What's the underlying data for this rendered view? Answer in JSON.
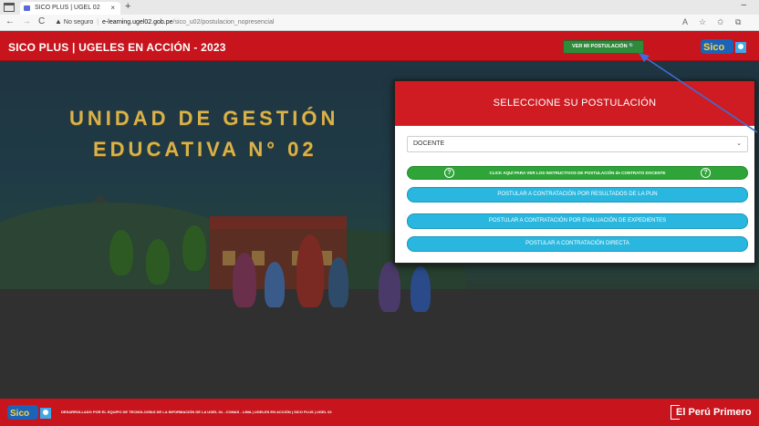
{
  "browser": {
    "tab_title": "SICO PLUS | UGEL 02",
    "tab_close": "×",
    "new_tab": "+",
    "minimize": "–",
    "back": "←",
    "forward": "→",
    "reload": "C",
    "insecure_label": "No seguro",
    "url_host": "e-learning.ugel02.gob.pe",
    "url_path": "/sico_u02/postulacion_nopresencial"
  },
  "header": {
    "title": "SICO PLUS | UGELES EN ACCIÓN - 2023",
    "ver_button": "VER MI POSTULACIÓN 🔍",
    "logo_text": "Sico"
  },
  "hero": {
    "line1": "UNIDAD DE GESTIÓN",
    "line2": "EDUCATIVA N° 02"
  },
  "modal": {
    "title": "SELECCIONE SU POSTULACIÓN",
    "select_value": "DOCENTE",
    "green_button": "CLICK AQUÍ PARA VER LOS INSTRUCTIVOS DE POSTULACIÓN de CONTRATO DOCENTE",
    "help_icon": "?",
    "buttons": [
      "POSTULAR A CONTRATACIÓN POR RESULTADOS DE LA PUN",
      "POSTULAR A CONTRATACIÓN POR EVALUACIÓN DE EXPEDIENTES",
      "POSTULAR A CONTRATACIÓN DIRECTA"
    ]
  },
  "footer": {
    "logo_text": "Sico",
    "text": "DESARROLLADO POR EL EQUIPO DE TECNOLOGÍAS DE LA INFORMACIÓN DE LA UGEL 04 - COMAS - LIMA | UGELES EN ACCIÓN | SICO PLUS | UGEL 02",
    "brand": "El Perú Primero"
  },
  "colors": {
    "brand_red": "#c8141c",
    "green": "#2fa539",
    "blue": "#29b7df",
    "gold": "#d9b24a"
  }
}
